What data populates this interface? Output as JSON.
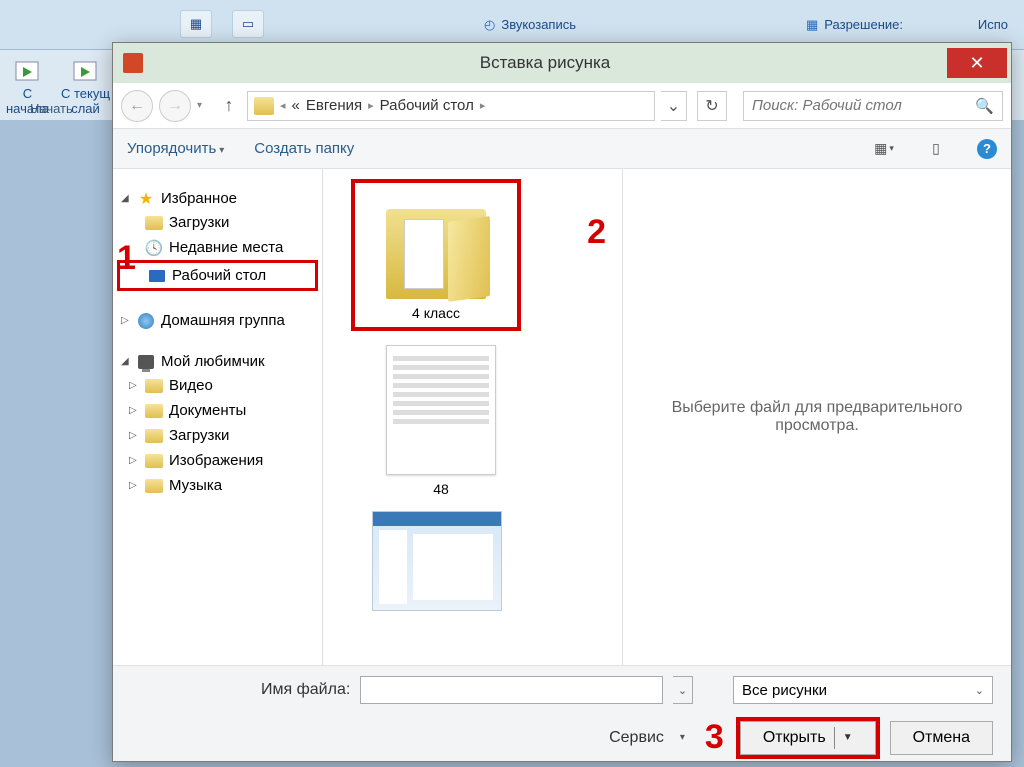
{
  "ribbon": {
    "sound": "Звукозапись",
    "resolution": "Разрешение:",
    "use": "Испо",
    "from_start": "С\nначала",
    "from_current": "С текущ\nслай",
    "section_start": "Начать"
  },
  "dialog": {
    "title": "Вставка рисунка",
    "close": "✕",
    "breadcrumb": {
      "pre": "«",
      "p1": "Евгения",
      "p2": "Рабочий стол"
    },
    "search_placeholder": "Поиск: Рабочий стол",
    "organize": "Упорядочить",
    "new_folder": "Создать папку"
  },
  "tree": {
    "favorites": "Избранное",
    "downloads": "Загрузки",
    "recent": "Недавние места",
    "desktop": "Рабочий стол",
    "homegroup": "Домашняя группа",
    "mypc": "Мой любимчик",
    "video": "Видео",
    "documents": "Документы",
    "downloads2": "Загрузки",
    "pictures": "Изображения",
    "music": "Музыка"
  },
  "files": {
    "folder1": "4 класс",
    "doc1": "48"
  },
  "preview": {
    "msg": "Выберите файл для предварительного просмотра."
  },
  "bottom": {
    "filename_label": "Имя файла:",
    "filter": "Все рисунки",
    "service": "Сервис",
    "open": "Открыть",
    "cancel": "Отмена"
  },
  "anno": {
    "a1": "1",
    "a2": "2",
    "a3": "3"
  }
}
